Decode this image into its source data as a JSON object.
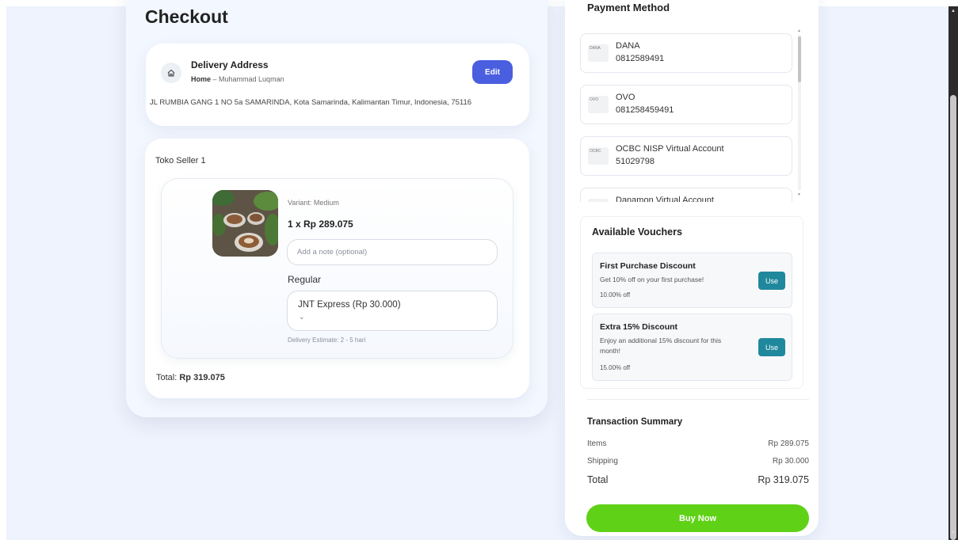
{
  "page": {
    "title": "Checkout"
  },
  "address": {
    "title": "Delivery Address",
    "label": "Home",
    "separator": " – ",
    "name": "Muhammad Luqman",
    "edit_label": "Edit",
    "full": "JL RUMBIA GANG 1 NO 5a SAMARINDA, Kota Samarinda, Kalimantan Timur, Indonesia, 75116"
  },
  "seller": {
    "name": "Toko Seller 1",
    "item": {
      "variant": "Variant: Medium",
      "qty_price": "1 x Rp 289.075",
      "note_placeholder": "Add a note (optional)",
      "shipping_type": "Regular",
      "courier": "JNT Express (Rp 30.000)",
      "delivery_estimate": "Delivery Estimate: 2 - 5 hari"
    },
    "total_label": "Total: ",
    "total_value": "Rp 319.075"
  },
  "payment": {
    "title": "Payment Method",
    "methods": [
      {
        "name": "DANA",
        "number": "0812589491",
        "logo_text": "DANA"
      },
      {
        "name": "OVO",
        "number": "081258459491",
        "logo_text": "OVO"
      },
      {
        "name": "OCBC NISP Virtual Account",
        "number": "51029798",
        "logo_text": "OCBC"
      },
      {
        "name": "Danamon Virtual Account",
        "number": "",
        "logo_text": ""
      }
    ]
  },
  "vouchers": {
    "title": "Available Vouchers",
    "items": [
      {
        "title": "First Purchase Discount",
        "desc": "Get 10% off on your first purchase!",
        "off": "10.00% off",
        "use_label": "Use"
      },
      {
        "title": "Extra 15% Discount",
        "desc": "Enjoy an additional 15% discount for this month!",
        "off": "15.00% off",
        "use_label": "Use"
      }
    ]
  },
  "summary": {
    "title": "Transaction Summary",
    "items_label": "Items",
    "items_value": "Rp 289.075",
    "shipping_label": "Shipping",
    "shipping_value": "Rp 30.000",
    "total_label": "Total",
    "total_value": "Rp 319.075"
  },
  "buy_label": "Buy Now",
  "colors": {
    "accent": "#4a5fe0",
    "buy": "#5fd116",
    "use_button": "#20889c",
    "background": "#eef3fd"
  }
}
